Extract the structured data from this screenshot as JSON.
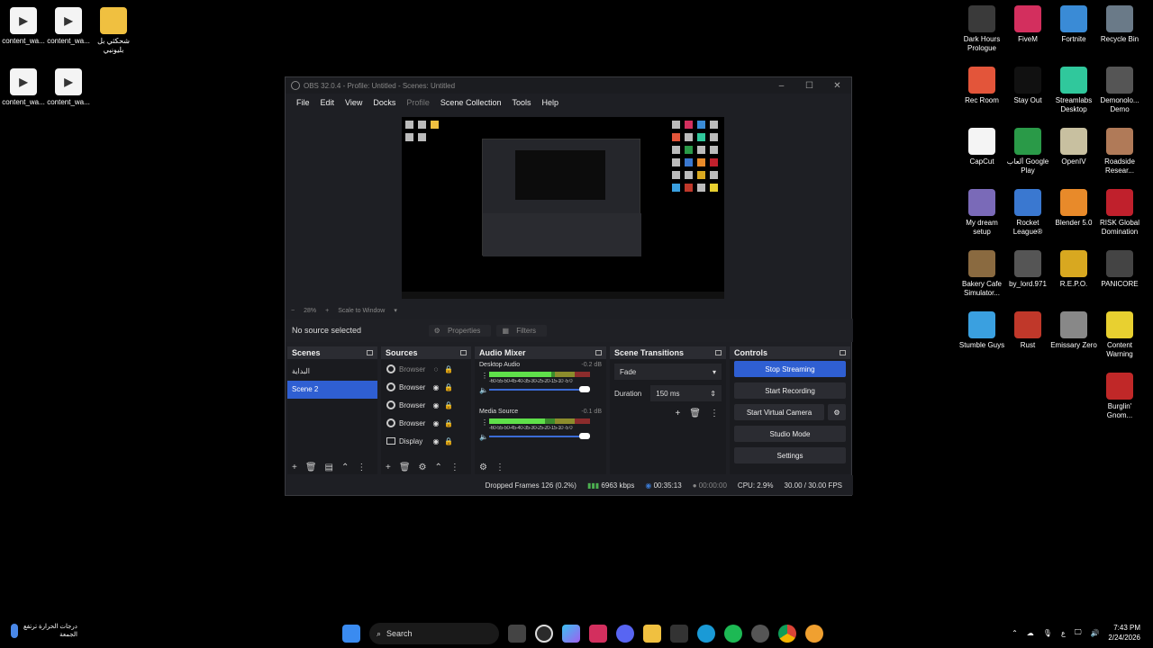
{
  "desktop_left": [
    {
      "label": "content_wa...",
      "kind": "doc"
    },
    {
      "label": "content_wa...",
      "kind": "doc"
    },
    {
      "label": "شحكثي بل بليونبي",
      "kind": "folder"
    },
    {
      "label": "content_wa...",
      "kind": "doc"
    },
    {
      "label": "content_wa...",
      "kind": "doc"
    }
  ],
  "desktop_right": [
    {
      "label": "Dark Hours Prologue",
      "color": "#3a3a3a"
    },
    {
      "label": "FiveM",
      "color": "#d32f5e"
    },
    {
      "label": "Fortnite",
      "color": "#3a8bd6"
    },
    {
      "label": "Recycle Bin",
      "color": "#6a7a88"
    },
    {
      "label": "Rec Room",
      "color": "#e3553a"
    },
    {
      "label": "Stay Out",
      "color": "#111111"
    },
    {
      "label": "Streamlabs Desktop",
      "color": "#30c89c"
    },
    {
      "label": "Demonolo... Demo",
      "color": "#555555"
    },
    {
      "label": "CapCut",
      "color": "#f4f4f4"
    },
    {
      "label": "ألعاب Google Play",
      "color": "#2a9a48"
    },
    {
      "label": "OpenIV",
      "color": "#c8c0a0"
    },
    {
      "label": "Roadside Resear...",
      "color": "#b07a58"
    },
    {
      "label": "My dream setup",
      "color": "#7a6ab8"
    },
    {
      "label": "Rocket League®",
      "color": "#3a78d0"
    },
    {
      "label": "Blender 5.0",
      "color": "#e88a2a"
    },
    {
      "label": "RISK Global Domination",
      "color": "#c0202c"
    },
    {
      "label": "Bakery Cafe Simulator...",
      "color": "#8a6a40"
    },
    {
      "label": "by_lord.971",
      "color": "#555555"
    },
    {
      "label": "R.E.P.O.",
      "color": "#d8a820"
    },
    {
      "label": "PANICORE",
      "color": "#444444"
    },
    {
      "label": "Stumble Guys",
      "color": "#3aa0e0"
    },
    {
      "label": "Rust",
      "color": "#c0382a"
    },
    {
      "label": "Emissary Zero",
      "color": "#888888"
    },
    {
      "label": "Content Warning",
      "color": "#e8d030"
    },
    {
      "label": "Burglin' Gnom...",
      "color": "#c02828"
    }
  ],
  "obs": {
    "title": "OBS 32.0.4 - Profile: Untitled - Scenes: Untitled",
    "menus": [
      "File",
      "Edit",
      "View",
      "Docks",
      "Profile",
      "Scene Collection",
      "Tools",
      "Help"
    ],
    "zoom": "28%",
    "scale_mode": "Scale to Window",
    "no_source": "No source selected",
    "properties_label": "Properties",
    "filters_label": "Filters",
    "scenes_title": "Scenes",
    "scenes": [
      "البداية",
      "Scene 2"
    ],
    "selected_scene": 1,
    "sources_title": "Sources",
    "sources": [
      {
        "name": "Browser",
        "icon": "globe-icon",
        "visible": "hidden"
      },
      {
        "name": "Browser",
        "icon": "globe-icon",
        "visible": "shown"
      },
      {
        "name": "Browser",
        "icon": "globe-icon",
        "visible": "shown"
      },
      {
        "name": "Browser",
        "icon": "globe-icon",
        "visible": "shown"
      },
      {
        "name": "Display",
        "icon": "monitor-icon",
        "visible": "shown"
      }
    ],
    "mixer_title": "Audio Mixer",
    "channels": [
      {
        "name": "Desktop Audio",
        "db": "-0.2 dB",
        "level": 0.62
      },
      {
        "name": "Media Source",
        "db": "-0.1 dB",
        "level": 0.55
      }
    ],
    "meter_scale": "-60-55-50-45-40-35-30-25-20-15-10 -5  0",
    "transitions_title": "Scene Transitions",
    "transition": "Fade",
    "duration_label": "Duration",
    "duration_value": "150 ms",
    "controls_title": "Controls",
    "controls": {
      "stream": "Stop Streaming",
      "record": "Start Recording",
      "vcam": "Start Virtual Camera",
      "studio": "Studio Mode",
      "settings": "Settings"
    },
    "status": {
      "dropped": "Dropped Frames 126 (0.2%)",
      "bitrate": "6963 kbps",
      "stream_time": "00:35:13",
      "rec_time": "00:00:00",
      "cpu": "CPU: 2.9%",
      "fps": "30.00 / 30.00 FPS"
    }
  },
  "taskbar": {
    "weather_line1": "درجات الحرارة ترتفع",
    "weather_line2": "الجمعة",
    "search": "Search",
    "time": "7:43 PM",
    "date": "2/24/2026"
  }
}
